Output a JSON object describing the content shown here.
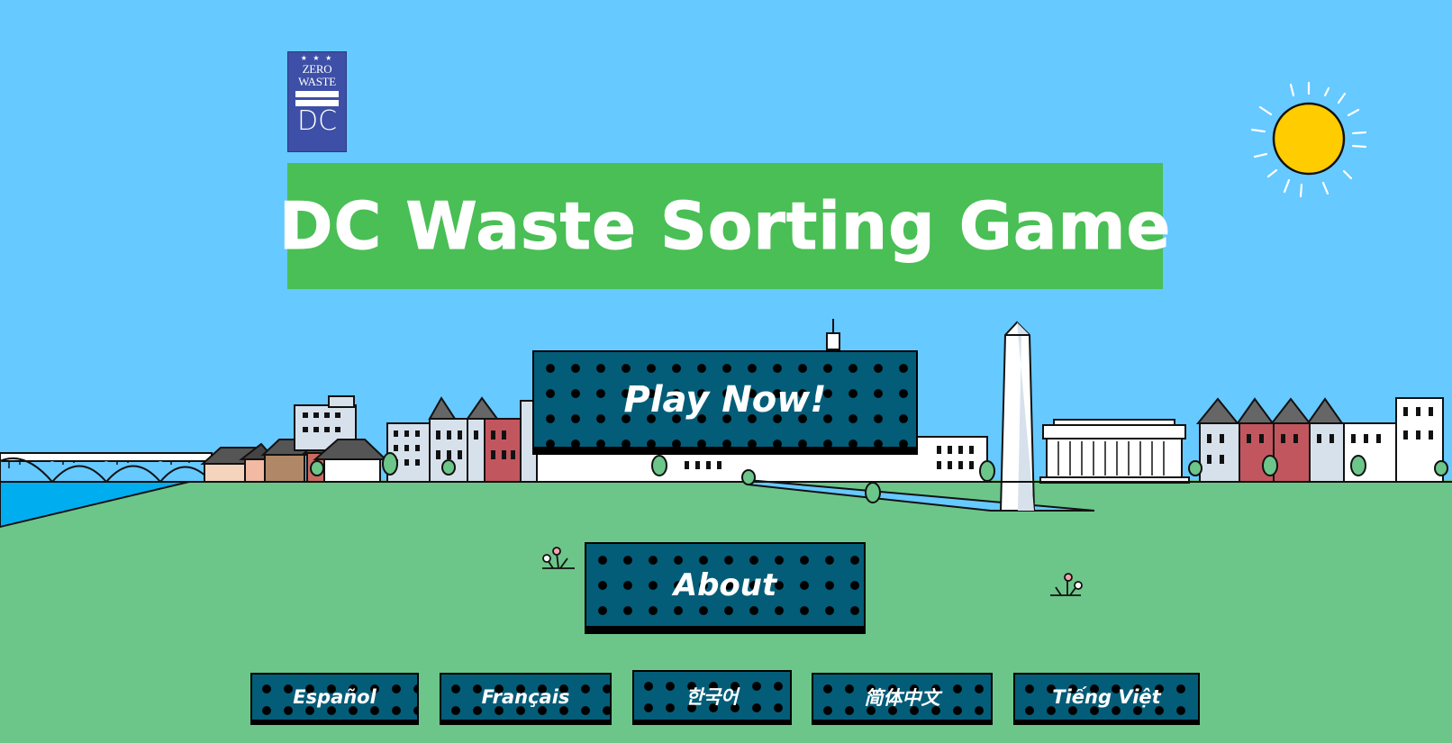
{
  "logo": {
    "stars": "★ ★ ★",
    "line1": "ZERO",
    "line2": "WASTE",
    "line3": "DC"
  },
  "title": "DC Waste Sorting Game",
  "buttons": {
    "play": "Play Now!",
    "about": "About"
  },
  "languages": [
    "Español",
    "Français",
    "한국어",
    "简体中文",
    "Tiếng Việt"
  ],
  "colors": {
    "sky": "#66c9ff",
    "grass": "#6cc689",
    "banner": "#49bf55",
    "button": "#045d78",
    "sun": "#ffcc00",
    "logo": "#3d4fa6"
  }
}
